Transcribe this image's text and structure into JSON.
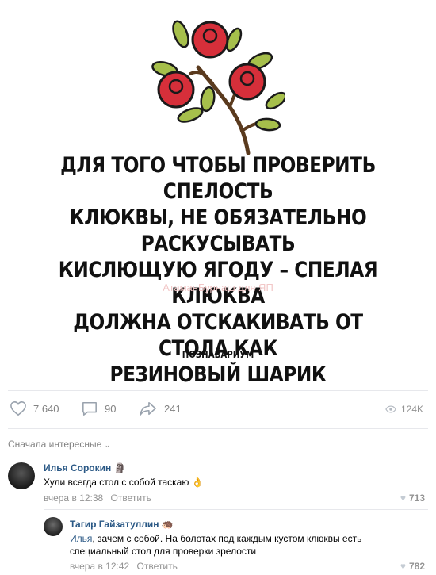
{
  "post": {
    "text_lines": [
      "ДЛЯ ТОГО ЧТОБЫ ПРОВЕРИТЬ СПЕЛОСТЬ",
      "КЛЮКВЫ, НЕ ОБЯЗАТЕЛЬНО РАСКУСЫВАТЬ",
      "КИСЛЮЩУЮ ЯГОДУ – СПЕЛАЯ КЛЮКВА",
      "ДОЛЖНА ОТСКАКИВАТЬ ОТ СТОЛА КАК",
      "РЕЗИНОВЫЙ ШАРИК"
    ],
    "watermark": "АтаманБурнаш для ЯП",
    "brand": "ПОЗНАВАРИУМ",
    "colors": {
      "berry": "#d62f3a",
      "leaf": "#a6bf4b",
      "stem": "#5a3a1e"
    }
  },
  "actions": {
    "likes": "7 640",
    "comments": "90",
    "shares": "241",
    "views": "124K"
  },
  "comments_header": {
    "sort_label": "Сначала интересные"
  },
  "comments": [
    {
      "author": "Илья Сорокин",
      "badge": "🗿",
      "text": "Хули всегда стол с собой таскаю",
      "emoji": "👌",
      "time": "вчера в 12:38",
      "reply_label": "Ответить",
      "likes": "713"
    },
    {
      "author": "Тагир Гайзатуллин",
      "badge": "🦔",
      "reply_to": "Илья",
      "text": ", зачем с собой. На болотах под каждым кустом клюквы есть",
      "text2": "специальный стол для проверки зрелости",
      "time": "вчера в 12:42",
      "reply_label": "Ответить",
      "likes": "782"
    }
  ]
}
